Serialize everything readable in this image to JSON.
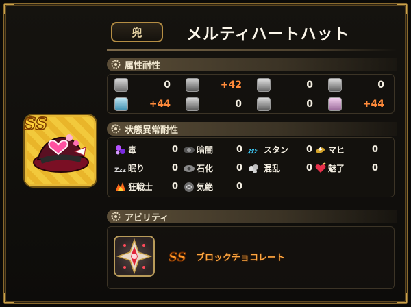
{
  "header": {
    "category": "兜",
    "item_name": "メルティハートハット"
  },
  "elemental": {
    "title": "属性耐性",
    "rows": [
      [
        {
          "icon": "fire-element-icon",
          "value": "0",
          "highlight": false
        },
        {
          "icon": "ice-element-icon",
          "value": "+42",
          "highlight": true
        },
        {
          "icon": "wind-element-icon",
          "value": "0",
          "highlight": false
        },
        {
          "icon": "explosion-element-icon",
          "value": "0",
          "highlight": false
        }
      ],
      [
        {
          "icon": "lightning-element-icon",
          "value": "+44",
          "highlight": true
        },
        {
          "icon": "earth-element-icon",
          "value": "0",
          "highlight": false
        },
        {
          "icon": "dark-element-icon",
          "value": "0",
          "highlight": false
        },
        {
          "icon": "light-element-icon",
          "value": "+44",
          "highlight": true
        }
      ]
    ]
  },
  "status": {
    "title": "状態異常耐性",
    "items": [
      {
        "label": "毒",
        "value": "0",
        "icon": "poison-icon"
      },
      {
        "label": "暗闇",
        "value": "0",
        "icon": "blind-icon"
      },
      {
        "label": "スタン",
        "value": "0",
        "icon": "stun-icon",
        "icon_text": "ｽﾀﾝ"
      },
      {
        "label": "マヒ",
        "value": "0",
        "icon": "paralysis-icon"
      },
      {
        "label": "眠り",
        "value": "0",
        "icon": "sleep-icon",
        "icon_text": "Zzz"
      },
      {
        "label": "石化",
        "value": "0",
        "icon": "petrify-icon"
      },
      {
        "label": "混乱",
        "value": "0",
        "icon": "confusion-icon"
      },
      {
        "label": "魅了",
        "value": "0",
        "icon": "charm-icon"
      },
      {
        "label": "狂戦士",
        "value": "0",
        "icon": "berserk-icon"
      },
      {
        "label": "気絶",
        "value": "0",
        "icon": "faint-icon"
      }
    ]
  },
  "ability": {
    "title": "アビリティ",
    "name": "ブロックチョコレート",
    "badge": "SS",
    "icon": "chocolate-gem-icon"
  },
  "item_icon": {
    "icon": "heart-hat-icon",
    "rank_badge": "SS"
  },
  "colors": {
    "highlight": "#ff8a3a",
    "frame": "#8a6a2e",
    "icon_bg": "#f2c93c"
  }
}
